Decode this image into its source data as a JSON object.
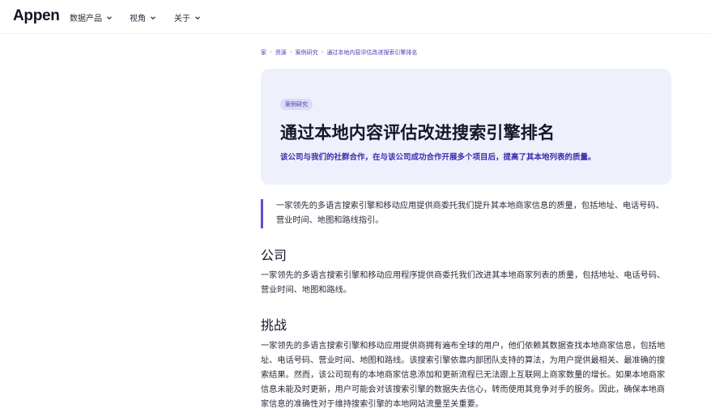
{
  "nav": {
    "logo": "Appen",
    "items": [
      {
        "label": "数据产品"
      },
      {
        "label": "视角"
      },
      {
        "label": "关于"
      }
    ]
  },
  "breadcrumb": {
    "items": [
      "家",
      "资源",
      "案例研究",
      "通过本地内容评估改进搜索引擎排名"
    ],
    "separator": "›"
  },
  "hero": {
    "badge": "案例研究",
    "title": "通过本地内容评估改进搜索引擎排名",
    "subtitle": "该公司与我们的社群合作，在与该公司成功合作开展多个项目后，提高了其本地列表的质量。"
  },
  "quote": "一家领先的多语言搜索引擎和移动应用提供商委托我们提升其本地商家信息的质量，包括地址、电话号码、营业时间、地图和路线指引。",
  "sections": [
    {
      "heading": "公司",
      "body": "一家领先的多语言搜索引擎和移动应用程序提供商委托我们改进其本地商家列表的质量，包括地址、电话号码、营业时间、地图和路线。"
    },
    {
      "heading": "挑战",
      "body": "一家领先的多语言搜索引擎和移动应用提供商拥有遍布全球的用户，他们依赖其数据查找本地商家信息，包括地址、电话号码、营业时间、地图和路线。该搜索引擎依靠内部团队支持的算法，为用户提供最相关、最准确的搜索结果。然而，该公司现有的本地商家信息添加和更新流程已无法跟上互联网上商家数量的增长。如果本地商家信息未能及时更新，用户可能会对该搜索引擎的数据失去信心，转而使用其竞争对手的服务。因此，确保本地商家信息的准确性对于维持搜索引擎的本地网站流量至关重要。"
    }
  ],
  "colors": {
    "accent": "#4a3fb5",
    "hero_bg": "#eef0fb",
    "quote_bar": "#5b4fd0"
  }
}
